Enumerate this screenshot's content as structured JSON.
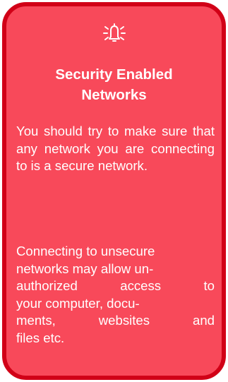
{
  "card": {
    "icon": "bell-alert-icon",
    "title_line1": "Security Enabled",
    "title_line2": "Networks",
    "paragraph1": "You should try to make sure that any network you are connecting to is a secure network.",
    "paragraph2_lines": [
      "Connecting to unsecure",
      "networks may allow un-",
      "authorized access to",
      "your computer, docu-",
      "ments, websites and",
      "files etc."
    ]
  },
  "colors": {
    "card_fill": "#f8495a",
    "card_border": "#d10017",
    "text": "#ffffff"
  }
}
